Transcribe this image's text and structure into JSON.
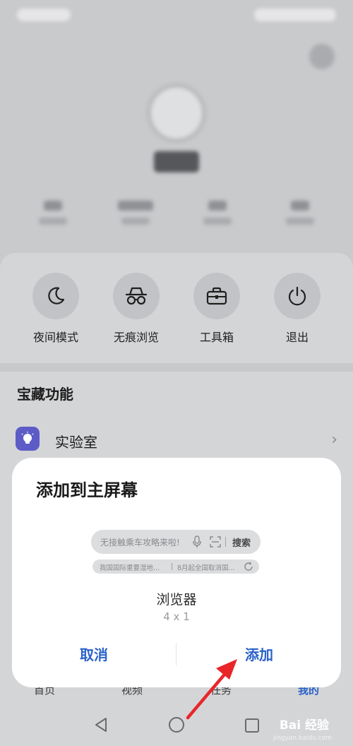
{
  "quick_actions": [
    {
      "label": "夜间模式",
      "icon": "moon-icon"
    },
    {
      "label": "无痕浏览",
      "icon": "incognito-icon"
    },
    {
      "label": "工具箱",
      "icon": "toolbox-icon"
    },
    {
      "label": "退出",
      "icon": "power-icon"
    }
  ],
  "section": {
    "title": "宝藏功能",
    "lab_label": "实验室"
  },
  "bottom_nav": {
    "items": [
      "首页",
      "视频",
      "任务",
      "我的"
    ],
    "active_index": 3
  },
  "dialog": {
    "title": "添加到主屏幕",
    "widget": {
      "search_placeholder": "无接触乘车攻略来啦!",
      "search_button": "搜索",
      "news_1": "我国国际重要湿地...",
      "news_2": "8月起全国取消国..."
    },
    "app_name": "浏览器",
    "widget_size": "4 x 1",
    "cancel_label": "取消",
    "add_label": "添加"
  },
  "watermark": {
    "text": "Bai 经验",
    "sub": "jingyan.baidu.com"
  },
  "colors": {
    "accent": "#2a62c9",
    "annotation_arrow": "#e8262a",
    "lab_icon_bg": "#5d5cc7"
  }
}
